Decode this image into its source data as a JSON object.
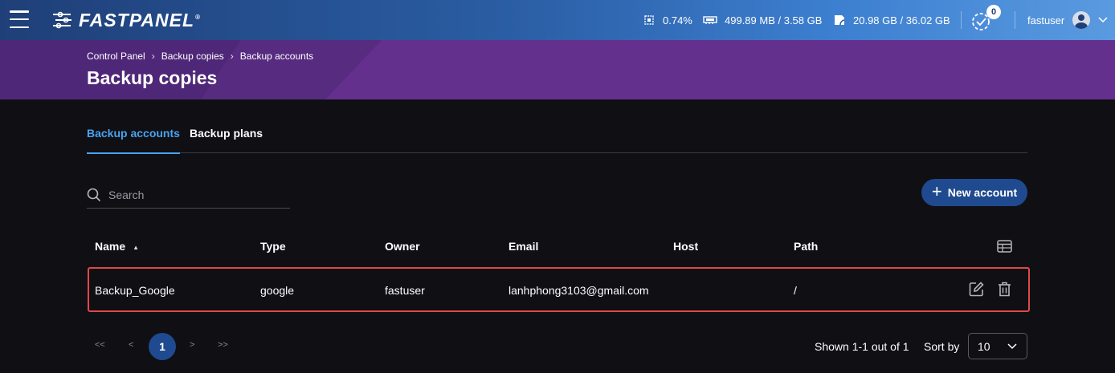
{
  "topbar": {
    "logo_text": "FASTPANEL",
    "logo_reg": "®",
    "cpu": "0.74%",
    "ram": "499.89 MB / 3.58 GB",
    "disk": "20.98 GB / 36.02 GB",
    "tasks_count": "0",
    "username": "fastuser"
  },
  "breadcrumb": [
    "Control Panel",
    "Backup copies",
    "Backup accounts"
  ],
  "breadcrumb_sep": "›",
  "page_title": "Backup copies",
  "tabs": [
    {
      "label": "Backup accounts",
      "active": true
    },
    {
      "label": "Backup plans",
      "active": false
    }
  ],
  "search": {
    "placeholder": "Search",
    "value": ""
  },
  "new_account_label": "New account",
  "table": {
    "columns": [
      "Name",
      "Type",
      "Owner",
      "Email",
      "Host",
      "Path"
    ],
    "rows": [
      {
        "name": "Backup_Google",
        "type": "google",
        "owner": "fastuser",
        "email": "lanhphong3103@gmail.com",
        "host": "",
        "path": "/"
      }
    ]
  },
  "pagination": {
    "first": "<<",
    "prev": "<",
    "current": "1",
    "next": ">",
    "last": ">>",
    "shown": "Shown 1-1 out of 1",
    "sort_by_label": "Sort by",
    "per_page": "10"
  },
  "colors": {
    "accent": "#4aa3f0",
    "primary_button": "#1f4a8f",
    "header_purple": "#63308d",
    "highlight": "#e04848"
  }
}
